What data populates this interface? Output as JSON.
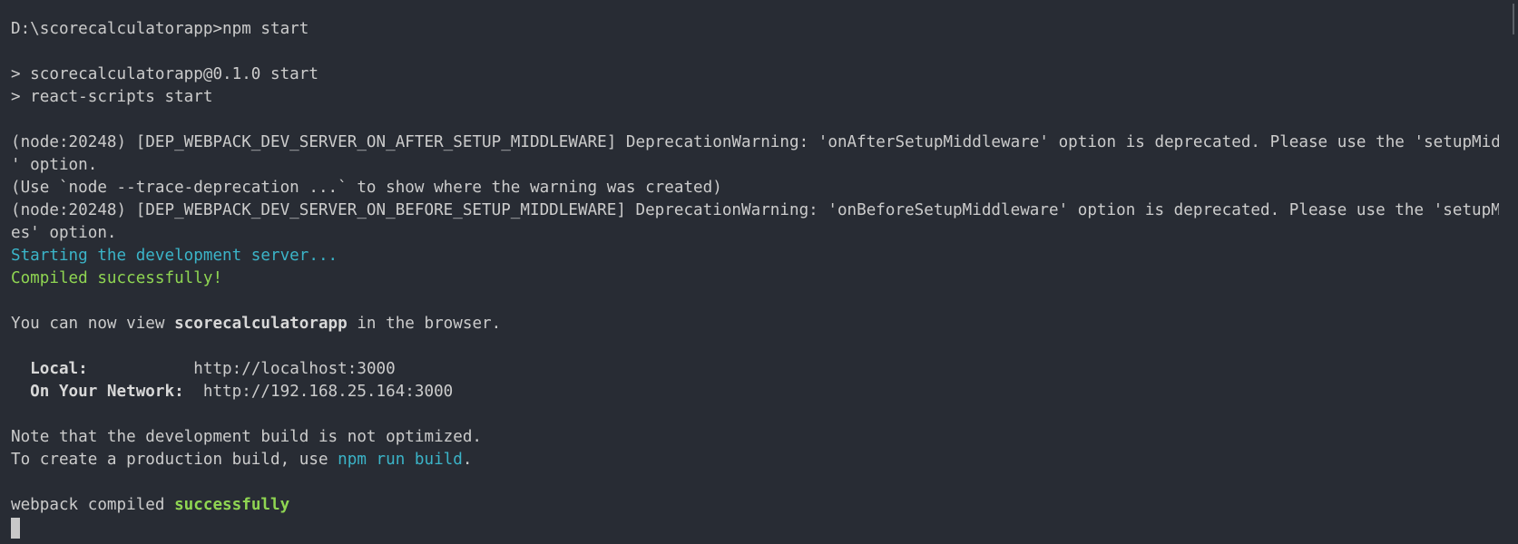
{
  "terminal": {
    "lines": [
      "D:\\scorecalculatorapp>npm start",
      "",
      "> scorecalculatorapp@0.1.0 start",
      "> react-scripts start",
      "",
      "(node:20248) [DEP_WEBPACK_DEV_SERVER_ON_AFTER_SETUP_MIDDLEWARE] DeprecationWarning: 'onAfterSetupMiddleware' option is deprecated. Please use the 'setupMiddlewares",
      "' option.",
      "(Use `node --trace-deprecation ...` to show where the warning was created)",
      "(node:20248) [DEP_WEBPACK_DEV_SERVER_ON_BEFORE_SETUP_MIDDLEWARE] DeprecationWarning: 'onBeforeSetupMiddleware' option is deprecated. Please use the 'setupMiddlewar",
      "es' option.",
      "Starting the development server...",
      "Compiled successfully!",
      "",
      "",
      "",
      "",
      "",
      "",
      "Note that the development build is not optimized.",
      "",
      "",
      "webpack compiled "
    ],
    "view_line": {
      "prefix": "You can now view ",
      "app_name": "scorecalculatorapp",
      "suffix": " in the browser."
    },
    "local": {
      "label": "  Local:",
      "spacer": "           ",
      "url": "http://localhost:3000"
    },
    "network": {
      "label": "  On Your Network:",
      "spacer": "  ",
      "url": "http://192.168.25.164:3000"
    },
    "production_line": {
      "prefix": "To create a production build, use ",
      "command": "npm run build",
      "suffix": "."
    },
    "webpack_status": "successfully",
    "colors": {
      "background": "#282c34",
      "text": "#cccccc",
      "info": "#3bb4c8",
      "success": "#8fd552"
    }
  }
}
